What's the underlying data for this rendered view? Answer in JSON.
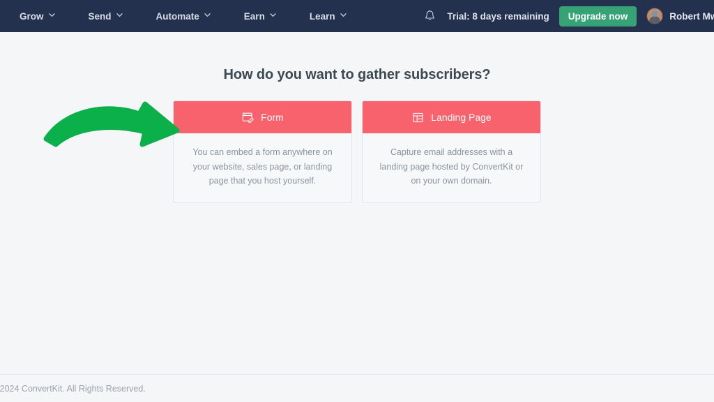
{
  "navbar": {
    "menu_items": [
      {
        "label": "Grow",
        "icon": "chevron-down-icon"
      },
      {
        "label": "Send",
        "icon": "chevron-down-icon"
      },
      {
        "label": "Automate",
        "icon": "chevron-down-icon"
      },
      {
        "label": "Earn",
        "icon": "chevron-down-icon"
      },
      {
        "label": "Learn",
        "icon": "chevron-down-icon"
      }
    ],
    "notifications_icon": "bell-icon",
    "trial_text": "Trial: 8 days remaining",
    "upgrade_label": "Upgrade now",
    "user_name": "Robert Mwar",
    "avatar_icon": "user-avatar",
    "background_color": "#23304e",
    "upgrade_color": "#36a276"
  },
  "main": {
    "title": "How do you want to gather subscribers?",
    "cards": [
      {
        "icon": "form-window-pencil-icon",
        "title": "Form",
        "description": "You can embed a form anywhere on your website, sales page, or landing page that you host yourself."
      },
      {
        "icon": "landing-page-layout-icon",
        "title": "Landing Page",
        "description": "Capture email addresses with a landing page hosted by ConvertKit or on your own domain."
      }
    ],
    "card_header_color": "#f8626c",
    "annotation": {
      "icon": "green-curved-arrow",
      "color": "#0bb04a",
      "points_to": "Form"
    }
  },
  "footer": {
    "copyright": "- 2024 ConvertKit. All Rights Reserved."
  }
}
